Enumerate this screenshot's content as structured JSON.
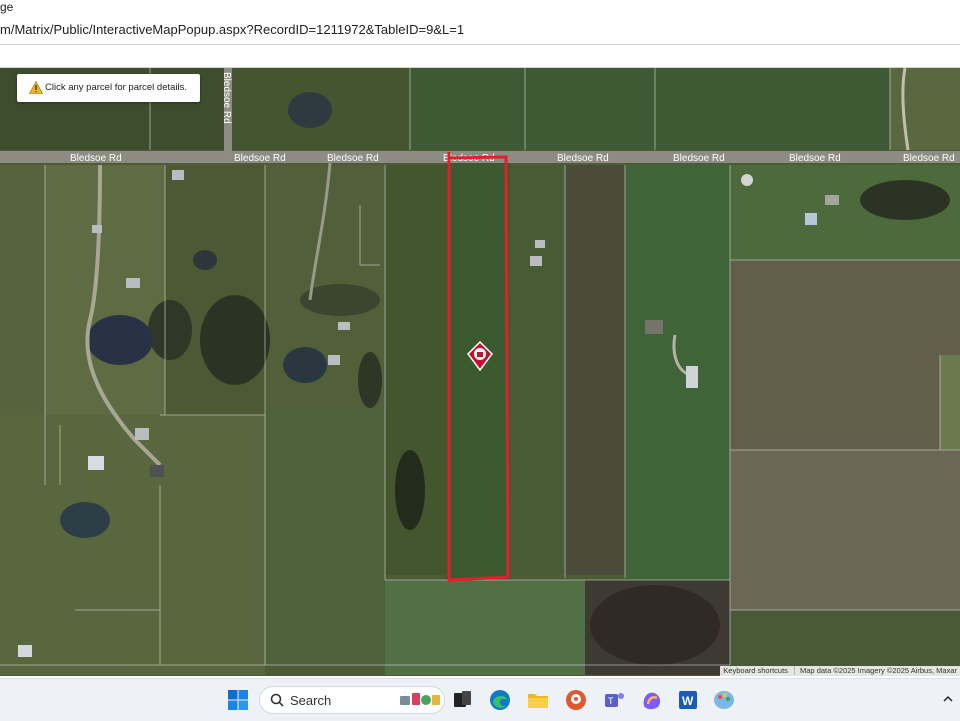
{
  "window": {
    "title_fragment": "ge"
  },
  "addressbar": {
    "url": "m/Matrix/Public/InteractiveMapPopup.aspx?RecordID=1211972&TableID=9&L=1"
  },
  "map": {
    "tooltip": "Click any parcel for parcel details.",
    "road_labels": [
      "Bledsoe Rd",
      "Bledsoe Rd",
      "Bledsoe Rd",
      "Bledsoe Rd",
      "Bledsoe Rd",
      "Bledsoe Rd",
      "Bledsoe Rd",
      "Bledsoe Rd"
    ],
    "road_label_vertical": "Bledsoe Rd",
    "attribution": {
      "keyboard": "Keyboard shortcuts",
      "data": "Map data ©2025 Imagery ©2025 Airbus, Maxar"
    },
    "colors": {
      "parcel_outline": "#e0202a",
      "marker": "#c8102e"
    }
  },
  "taskbar": {
    "search_placeholder": "Search",
    "icons": [
      "windows-start-icon",
      "search-icon",
      "task-view-icon",
      "edge-icon",
      "file-explorer-icon",
      "duckduckgo-icon",
      "teams-icon",
      "copilot-icon",
      "word-icon",
      "paint-icon",
      "chevron-up-icon"
    ]
  }
}
